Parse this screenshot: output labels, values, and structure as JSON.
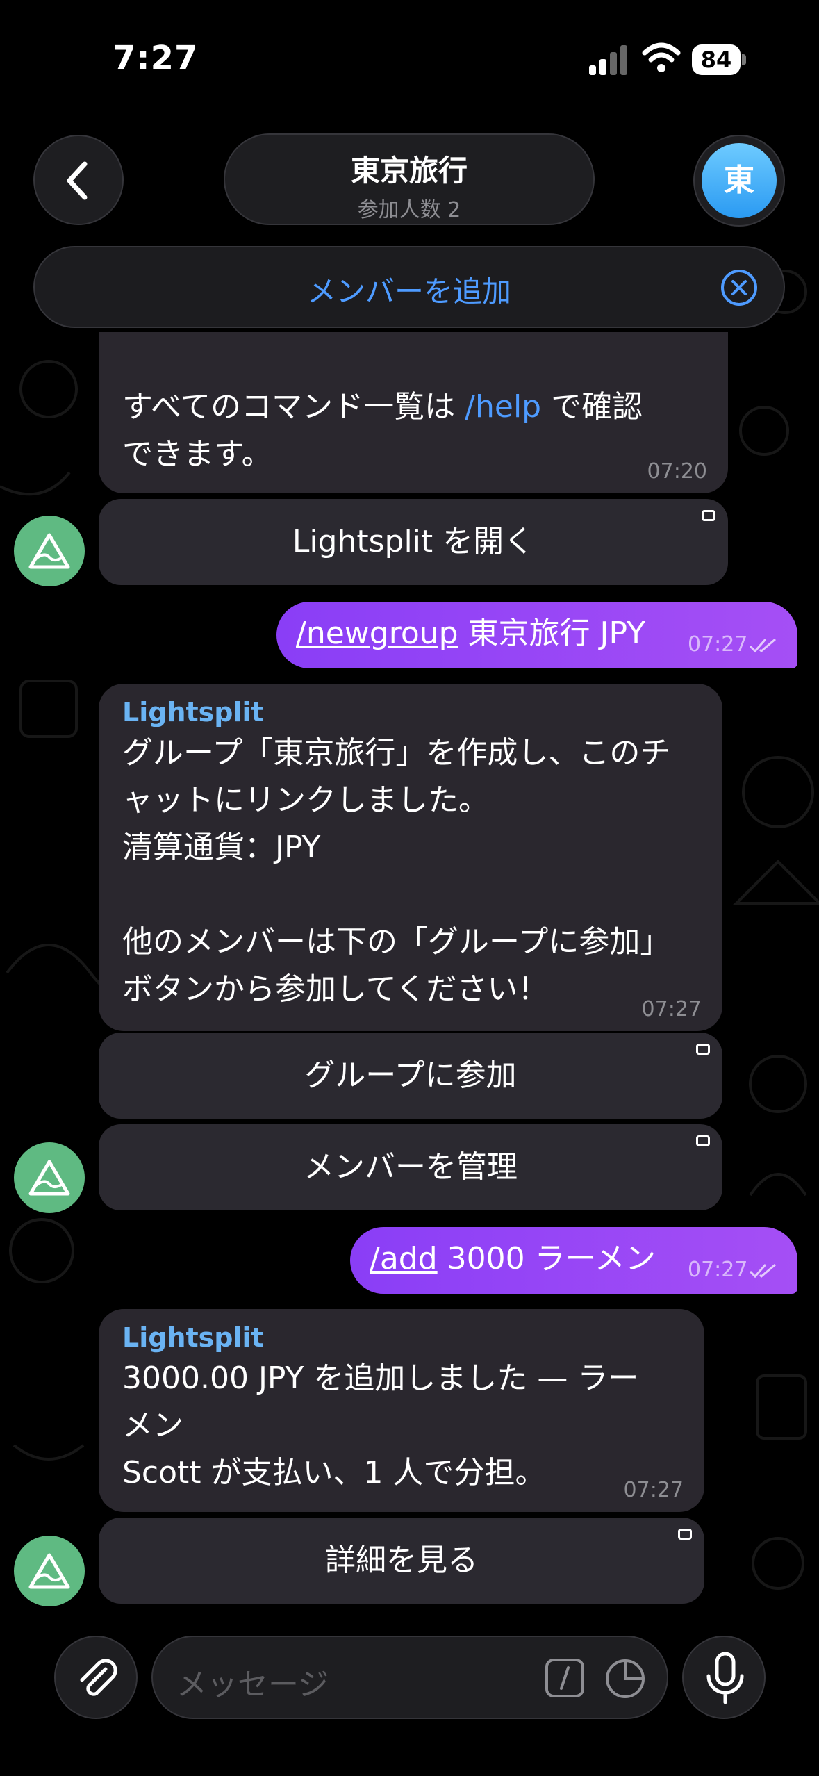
{
  "status_bar": {
    "time": "7:27",
    "battery": "84"
  },
  "header": {
    "back_icon": "chevron-left-icon",
    "title": "東京旅行",
    "subtitle": "参加人数 2",
    "avatar_letter": "東"
  },
  "add_member_bar": {
    "label": "メンバーを追加",
    "close_icon": "close-circle-icon"
  },
  "messages": [
    {
      "from": "bot",
      "text_before": "すべてのコマンド一覧は ",
      "command": "/help",
      "text_after": " で確認\nできます。",
      "time": "07:20",
      "buttons": [
        "Lightsplit を開く"
      ]
    },
    {
      "from": "me",
      "command": "/newgroup",
      "text": " 東京旅行 JPY",
      "time": "07:27"
    },
    {
      "from": "bot",
      "sender": "Lightsplit",
      "text": "グループ「東京旅行」を作成し、このチ\nャットにリンクしました。\n清算通貨：JPY\n\n他のメンバーは下の「グループに参加」\nボタンから参加してください！",
      "time": "07:27",
      "buttons": [
        "グループに参加",
        "メンバーを管理"
      ]
    },
    {
      "from": "me",
      "command": "/add",
      "text": " 3000 ラーメン",
      "time": "07:27"
    },
    {
      "from": "bot",
      "sender": "Lightsplit",
      "text": "3000.00 JPY を追加しました — ラー\nメン\nScott が支払い、1 人で分担。",
      "time": "07:27",
      "buttons": [
        "詳細を見る"
      ]
    }
  ],
  "input_bar": {
    "placeholder": "メッセージ",
    "attach_icon": "paperclip-icon",
    "command_icon": "slash-command-icon",
    "sticker_icon": "sticker-icon",
    "mic_icon": "microphone-icon"
  },
  "colors": {
    "accent": "#4e9bff",
    "outgoing": "#9747f5",
    "bot_avatar": "#5fba82",
    "sender_name": "#6ab3f3"
  }
}
